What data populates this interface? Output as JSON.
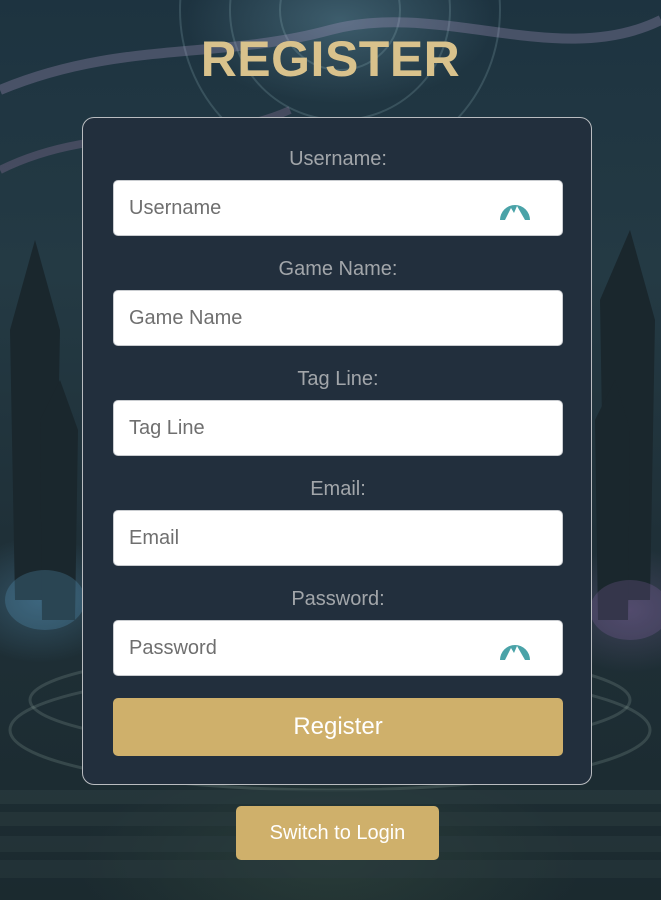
{
  "page": {
    "title": "REGISTER"
  },
  "form": {
    "username": {
      "label": "Username:",
      "placeholder": "Username",
      "value": ""
    },
    "game_name": {
      "label": "Game Name:",
      "placeholder": "Game Name",
      "value": ""
    },
    "tag_line": {
      "label": "Tag Line:",
      "placeholder": "Tag Line",
      "value": ""
    },
    "email": {
      "label": "Email:",
      "placeholder": "Email",
      "value": ""
    },
    "password": {
      "label": "Password:",
      "placeholder": "Password",
      "value": ""
    },
    "submit_label": "Register"
  },
  "footer": {
    "switch_label": "Switch to Login"
  },
  "icons": {
    "field_extension_icon": "password-manager-icon"
  },
  "colors": {
    "title": "#d9c28c",
    "card_background": "#222f3d",
    "button_accent": "#cfb06b",
    "label_text": "#a2a6aa",
    "extension_icon": "#4aa3a8"
  }
}
